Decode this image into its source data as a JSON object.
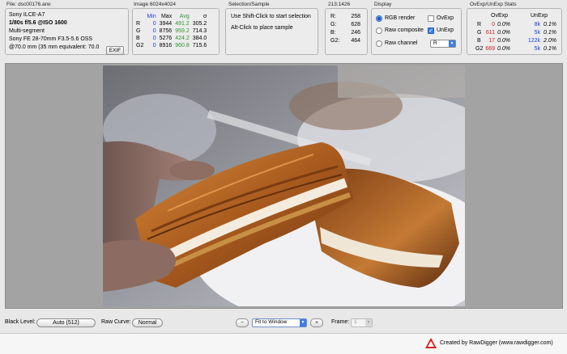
{
  "file": {
    "title": "File: dsc00176.arw",
    "camera": "Sony ILCE-A7",
    "exposure": "1/80s f/5.6 @ISO 1600",
    "metering": "Multi-segment",
    "lens": "Sony FE 28-70mm F3.5-5.6 OSS",
    "focal": "@70.0 mm (35 mm equivalent: 70.0",
    "exif_button": "EXIF"
  },
  "image_stats": {
    "title": "Image 6024x4024",
    "headers": [
      "Min",
      "Max",
      "Avg",
      "σ"
    ],
    "rows": [
      {
        "ch": "R",
        "min": "0",
        "max": "3944",
        "avg": "491.2",
        "sigma": "305.2"
      },
      {
        "ch": "G",
        "min": "0",
        "max": "8756",
        "avg": "959.2",
        "sigma": "714.3"
      },
      {
        "ch": "B",
        "min": "0",
        "max": "5276",
        "avg": "424.2",
        "sigma": "384.0"
      },
      {
        "ch": "G2",
        "min": "0",
        "max": "8916",
        "avg": "960.8",
        "sigma": "715.6"
      }
    ]
  },
  "selection": {
    "title": "Selection/Sample",
    "line1": "Use Shift-Click to start selection",
    "line2": "Alt-Click to place sample"
  },
  "coords": {
    "title": "213:1426",
    "rows": [
      {
        "ch": "R:",
        "val": "258"
      },
      {
        "ch": "G:",
        "val": "628"
      },
      {
        "ch": "B:",
        "val": "246"
      },
      {
        "ch": "G2:",
        "val": "464"
      }
    ]
  },
  "display": {
    "title": "Display",
    "rgb_render": "RGB render",
    "raw_composite": "Raw composite",
    "raw_channel": "Raw channel",
    "ovexp": "OvExp",
    "unexp": "UnExp",
    "channel_value": "R"
  },
  "ovexp_stats": {
    "title": "OvExp/UnExp Stats",
    "headers": [
      "OvExp",
      "UnExp"
    ],
    "rows": [
      {
        "ch": "R",
        "ov_n": "0",
        "ov_p": "0.0%",
        "un_n": "8k",
        "un_p": "0.1%"
      },
      {
        "ch": "G",
        "ov_n": "611",
        "ov_p": "0.0%",
        "un_n": "5k",
        "un_p": "0.1%"
      },
      {
        "ch": "B",
        "ov_n": "17",
        "ov_p": "0.0%",
        "un_n": "122k",
        "un_p": "2.0%"
      },
      {
        "ch": "G2",
        "ov_n": "669",
        "ov_p": "0.0%",
        "un_n": "5k",
        "un_p": "0.1%"
      }
    ]
  },
  "bottom": {
    "black_level_label": "Black Level:",
    "black_level_value": "Auto (512)",
    "raw_curve_label": "Raw Curve:",
    "raw_curve_value": "Normal",
    "zoom_out": "−",
    "zoom_mode": "Fit to Window",
    "zoom_in": "+",
    "frame_label": "Frame:",
    "frame_value": "1"
  },
  "footer": {
    "credit": "Created by RawDigger (www.rawdigger.com)"
  },
  "colors": {
    "blue": "#1a3fd8",
    "green": "#2a9a2a",
    "red": "#d11b1b",
    "viewer_bg": "#a3a3a3"
  }
}
